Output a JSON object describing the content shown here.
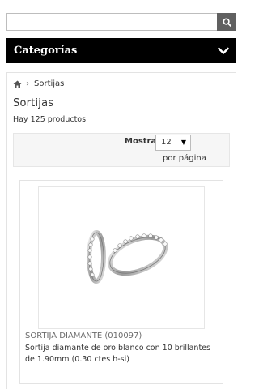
{
  "search": {
    "value": "",
    "placeholder": "",
    "icon": "search-icon"
  },
  "categories": {
    "title": "Categorías",
    "icon": "chevron-down-icon"
  },
  "breadcrumb": {
    "home_icon": "home-icon",
    "separator": "›",
    "current": "Sortijas"
  },
  "page": {
    "title": "Sortijas",
    "count_text": "Hay 125 productos."
  },
  "pagination": {
    "show_label": "Mostrar",
    "selected": "12",
    "per_page_label": "por página"
  },
  "product": {
    "name": "SORTIJA DIAMANTE (010097)",
    "description": "Sortija diamante de oro blanco con 10 brillantes de 1.90mm (0.30 ctes h-si)"
  }
}
